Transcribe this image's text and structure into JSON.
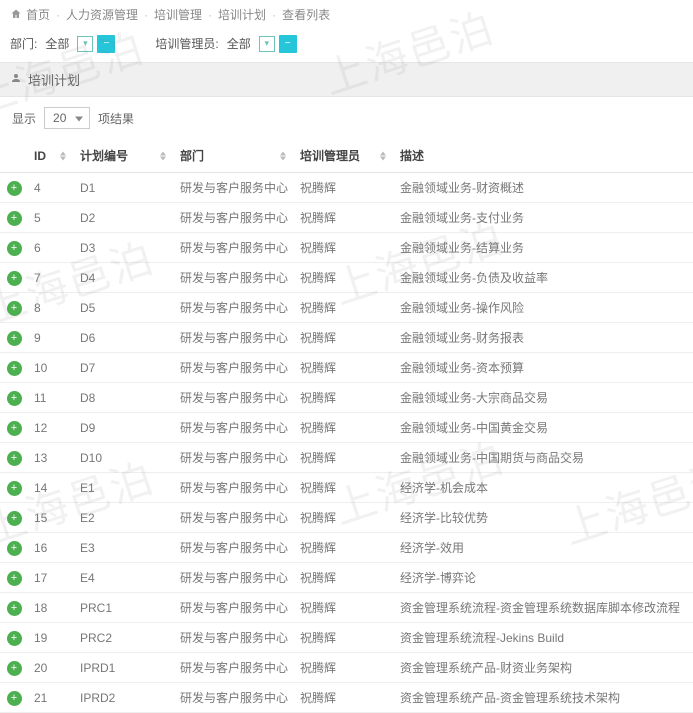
{
  "breadcrumb": {
    "home": "首页",
    "hr": "人力资源管理",
    "training_mgmt": "培训管理",
    "training_plan": "培训计划",
    "view_list": "查看列表"
  },
  "filters": {
    "dept_label": "部门:",
    "dept_value": "全部",
    "mgr_label": "培训管理员:",
    "mgr_value": "全部"
  },
  "panel": {
    "title": "培训计划"
  },
  "pager": {
    "show_label": "显示",
    "page_size": "20",
    "results_label": "项结果"
  },
  "columns": {
    "id": "ID",
    "plan_no": "计划编号",
    "dept": "部门",
    "manager": "培训管理员",
    "desc": "描述"
  },
  "rows": [
    {
      "id": "4",
      "plan": "D1",
      "dept": "研发与客户服务中心",
      "mgr": "祝腾辉",
      "desc": "金融领域业务-财资概述"
    },
    {
      "id": "5",
      "plan": "D2",
      "dept": "研发与客户服务中心",
      "mgr": "祝腾辉",
      "desc": "金融领域业务-支付业务"
    },
    {
      "id": "6",
      "plan": "D3",
      "dept": "研发与客户服务中心",
      "mgr": "祝腾辉",
      "desc": "金融领域业务-结算业务"
    },
    {
      "id": "7",
      "plan": "D4",
      "dept": "研发与客户服务中心",
      "mgr": "祝腾辉",
      "desc": "金融领域业务-负债及收益率"
    },
    {
      "id": "8",
      "plan": "D5",
      "dept": "研发与客户服务中心",
      "mgr": "祝腾辉",
      "desc": "金融领域业务-操作风险"
    },
    {
      "id": "9",
      "plan": "D6",
      "dept": "研发与客户服务中心",
      "mgr": "祝腾辉",
      "desc": "金融领域业务-财务报表"
    },
    {
      "id": "10",
      "plan": "D7",
      "dept": "研发与客户服务中心",
      "mgr": "祝腾辉",
      "desc": "金融领域业务-资本预算"
    },
    {
      "id": "11",
      "plan": "D8",
      "dept": "研发与客户服务中心",
      "mgr": "祝腾辉",
      "desc": "金融领域业务-大宗商品交易"
    },
    {
      "id": "12",
      "plan": "D9",
      "dept": "研发与客户服务中心",
      "mgr": "祝腾辉",
      "desc": "金融领域业务-中国黄金交易"
    },
    {
      "id": "13",
      "plan": "D10",
      "dept": "研发与客户服务中心",
      "mgr": "祝腾辉",
      "desc": "金融领域业务-中国期货与商品交易"
    },
    {
      "id": "14",
      "plan": "E1",
      "dept": "研发与客户服务中心",
      "mgr": "祝腾辉",
      "desc": "经济学-机会成本"
    },
    {
      "id": "15",
      "plan": "E2",
      "dept": "研发与客户服务中心",
      "mgr": "祝腾辉",
      "desc": "经济学-比较优势"
    },
    {
      "id": "16",
      "plan": "E3",
      "dept": "研发与客户服务中心",
      "mgr": "祝腾辉",
      "desc": "经济学-效用"
    },
    {
      "id": "17",
      "plan": "E4",
      "dept": "研发与客户服务中心",
      "mgr": "祝腾辉",
      "desc": "经济学-博弈论"
    },
    {
      "id": "18",
      "plan": "PRC1",
      "dept": "研发与客户服务中心",
      "mgr": "祝腾辉",
      "desc": "资金管理系统流程-资金管理系统数据库脚本修改流程"
    },
    {
      "id": "19",
      "plan": "PRC2",
      "dept": "研发与客户服务中心",
      "mgr": "祝腾辉",
      "desc": "资金管理系统流程-Jekins Build"
    },
    {
      "id": "20",
      "plan": "IPRD1",
      "dept": "研发与客户服务中心",
      "mgr": "祝腾辉",
      "desc": "资金管理系统产品-财资业务架构"
    },
    {
      "id": "21",
      "plan": "IPRD2",
      "dept": "研发与客户服务中心",
      "mgr": "祝腾辉",
      "desc": "资金管理系统产品-资金管理系统技术架构"
    }
  ],
  "watermark": "上海邑泊"
}
